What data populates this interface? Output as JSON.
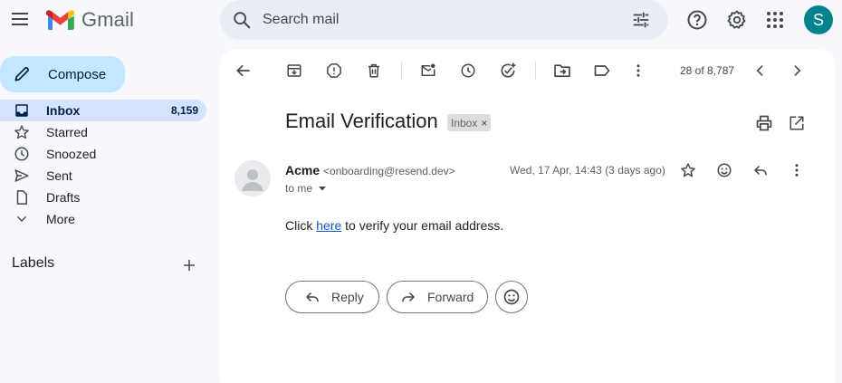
{
  "app": {
    "name": "Gmail"
  },
  "search": {
    "placeholder": "Search mail"
  },
  "account": {
    "initial": "S",
    "color": "#00838f"
  },
  "sidebar": {
    "compose_label": "Compose",
    "items": [
      {
        "label": "Inbox",
        "count": "8,159",
        "icon": "inbox-icon",
        "active": true
      },
      {
        "label": "Starred",
        "count": "",
        "icon": "star-icon"
      },
      {
        "label": "Snoozed",
        "count": "",
        "icon": "clock-icon"
      },
      {
        "label": "Sent",
        "count": "",
        "icon": "send-icon"
      },
      {
        "label": "Drafts",
        "count": "",
        "icon": "draft-icon"
      },
      {
        "label": "More",
        "count": "",
        "icon": "chevron-down-icon"
      }
    ],
    "labels_header": "Labels"
  },
  "toolbar": {
    "pager": "28 of 8,787"
  },
  "email": {
    "subject": "Email Verification",
    "label_chip": "Inbox",
    "label_chip_close": "×",
    "sender_name": "Acme",
    "sender_email": "<onboarding@resend.dev>",
    "to": "to me",
    "date": "Wed, 17 Apr, 14:43 (3 days ago)",
    "body_before": "Click ",
    "body_link": "here",
    "body_after": " to verify your email address."
  },
  "actions": {
    "reply": "Reply",
    "forward": "Forward"
  },
  "colors": {
    "background": "#f6f8fc",
    "compose": "#c2e7ff",
    "active_nav": "#d3e3fd",
    "search": "#e9eef6",
    "link": "#1155cc"
  }
}
